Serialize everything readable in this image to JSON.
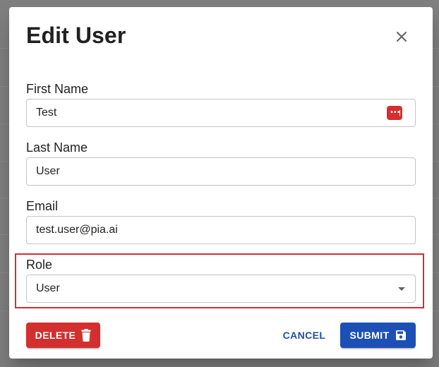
{
  "dialog": {
    "title": "Edit User"
  },
  "fields": {
    "first_name": {
      "label": "First Name",
      "value": "Test"
    },
    "last_name": {
      "label": "Last Name",
      "value": "User"
    },
    "email": {
      "label": "Email",
      "value": "test.user@pia.ai"
    },
    "role": {
      "label": "Role",
      "value": "User"
    }
  },
  "actions": {
    "delete_label": "DELETE",
    "cancel_label": "CANCEL",
    "submit_label": "SUBMIT"
  },
  "icons": {
    "close": "close-icon",
    "password_manager": "password-manager-icon",
    "delete": "trash-icon",
    "submit": "save-icon",
    "dropdown": "caret-down-icon"
  },
  "colors": {
    "danger": "#d32f2f",
    "primary": "#1d50b5",
    "highlight": "#d32f2f"
  }
}
